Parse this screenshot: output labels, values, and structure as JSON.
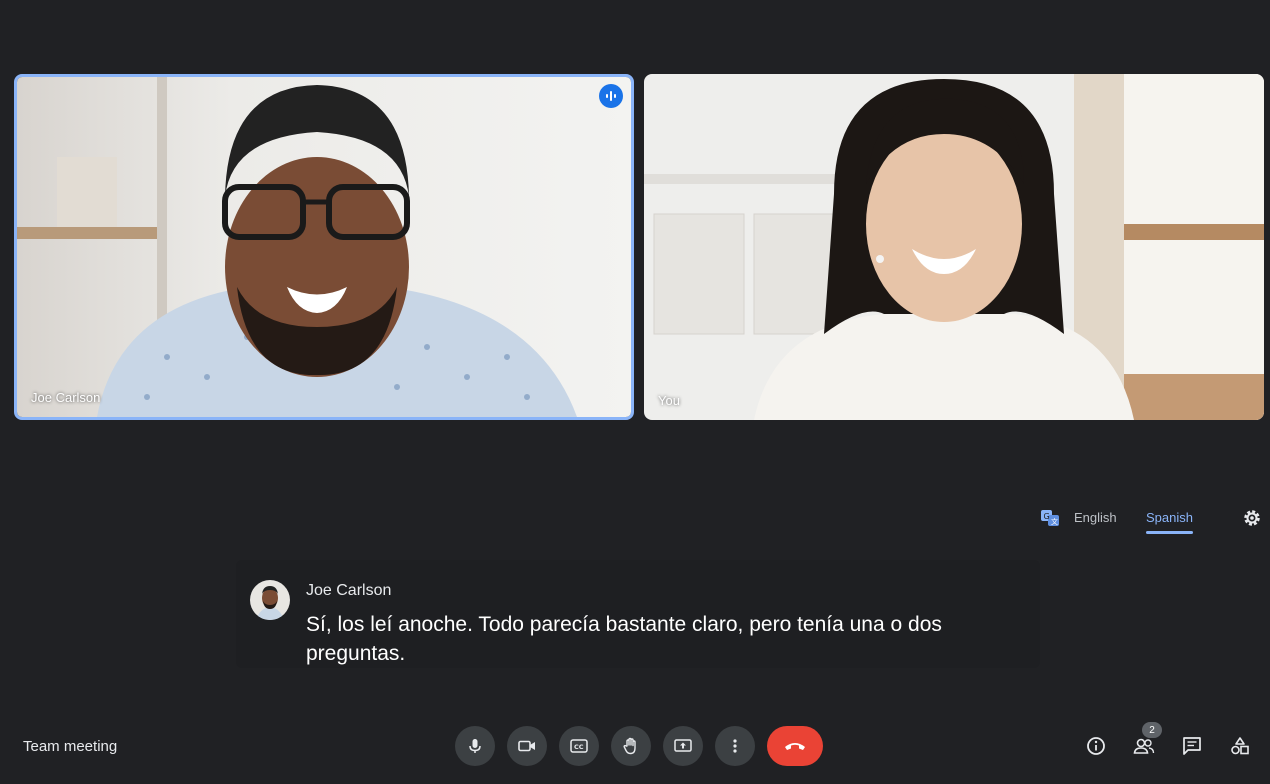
{
  "participants": [
    {
      "name": "Joe Carlson",
      "speaking": true
    },
    {
      "name": "You",
      "speaking": false
    }
  ],
  "captions": {
    "languages": [
      "English",
      "Spanish"
    ],
    "selected_language": "Spanish",
    "speaker": "Joe Carlson",
    "text": "Sí, los leí anoche. Todo parecía bastante claro, pero tenía una o dos preguntas."
  },
  "meeting": {
    "title": "Team meeting"
  },
  "people_count": "2",
  "colors": {
    "accent": "#8ab4f8",
    "end_call": "#ea4335",
    "background": "#202124"
  },
  "icons": [
    "speaking-icon",
    "translate-icon",
    "gear-icon",
    "mic-icon",
    "camera-icon",
    "captions-icon",
    "raise-hand-icon",
    "present-icon",
    "more-icon",
    "end-call-icon",
    "info-icon",
    "people-icon",
    "chat-icon",
    "activities-icon"
  ]
}
